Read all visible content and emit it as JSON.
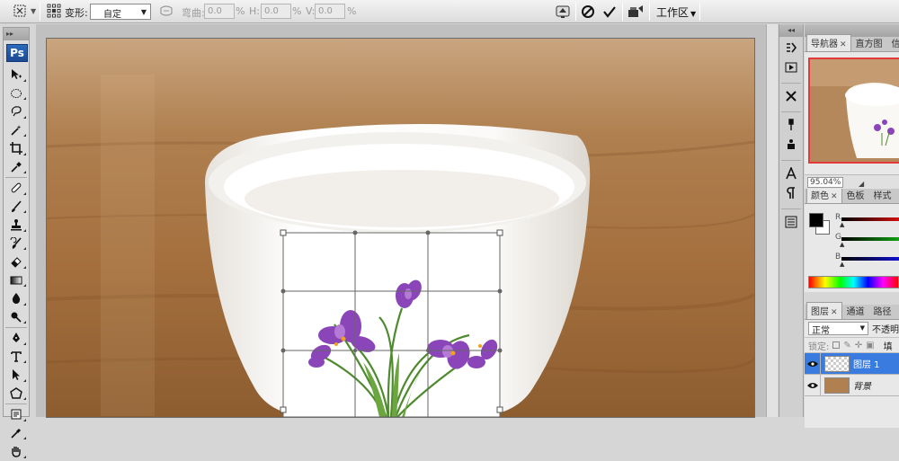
{
  "options_bar": {
    "transform_label": "变形:",
    "transform_value": "自定",
    "bend_label": "弯曲:",
    "bend_value": "0.0",
    "bend_unit": "%",
    "h_label": "H:",
    "h_value": "0.0",
    "h_unit": "%",
    "v_label": "V:",
    "v_value": "0.0",
    "v_unit": "%",
    "workspace_label": "工作区"
  },
  "toolbox": {
    "logo": "Ps",
    "tools": [
      "move-tool",
      "marquee-tool",
      "lasso-tool",
      "magic-wand-tool",
      "crop-tool",
      "eyedropper-tool",
      "healing-brush-tool",
      "brush-tool",
      "clone-stamp-tool",
      "history-brush-tool",
      "eraser-tool",
      "gradient-tool",
      "blur-tool",
      "dodge-tool",
      "pen-tool",
      "type-tool",
      "path-selection-tool",
      "shape-tool",
      "notes-tool",
      "eyedropper-tool-2",
      "hand-tool"
    ]
  },
  "navigator": {
    "tabs": [
      {
        "label": "导航器",
        "active": true
      },
      {
        "label": "直方图",
        "active": false
      },
      {
        "label": "信息",
        "active": false
      }
    ],
    "zoom": "95.04%"
  },
  "color_panel": {
    "tabs": [
      {
        "label": "颜色",
        "active": true
      },
      {
        "label": "色板",
        "active": false
      },
      {
        "label": "样式",
        "active": false
      }
    ],
    "channels": [
      {
        "label": "R",
        "color": "#d01010"
      },
      {
        "label": "G",
        "color": "#10a010"
      },
      {
        "label": "B",
        "color": "#1010d0"
      }
    ],
    "foreground": "#000000",
    "background": "#ffffff"
  },
  "layers_panel": {
    "tabs": [
      {
        "label": "图层",
        "active": true
      },
      {
        "label": "通道",
        "active": false
      },
      {
        "label": "路径",
        "active": false
      }
    ],
    "blend_mode": "正常",
    "opacity_label": "不透明",
    "lock_label": "锁定:",
    "fill_label": "填",
    "layers": [
      {
        "name": "图层 1",
        "selected": true
      },
      {
        "name": "背景",
        "selected": false
      }
    ]
  },
  "colors": {
    "accent": "#3a7be0",
    "selection": "#3a7be0"
  }
}
